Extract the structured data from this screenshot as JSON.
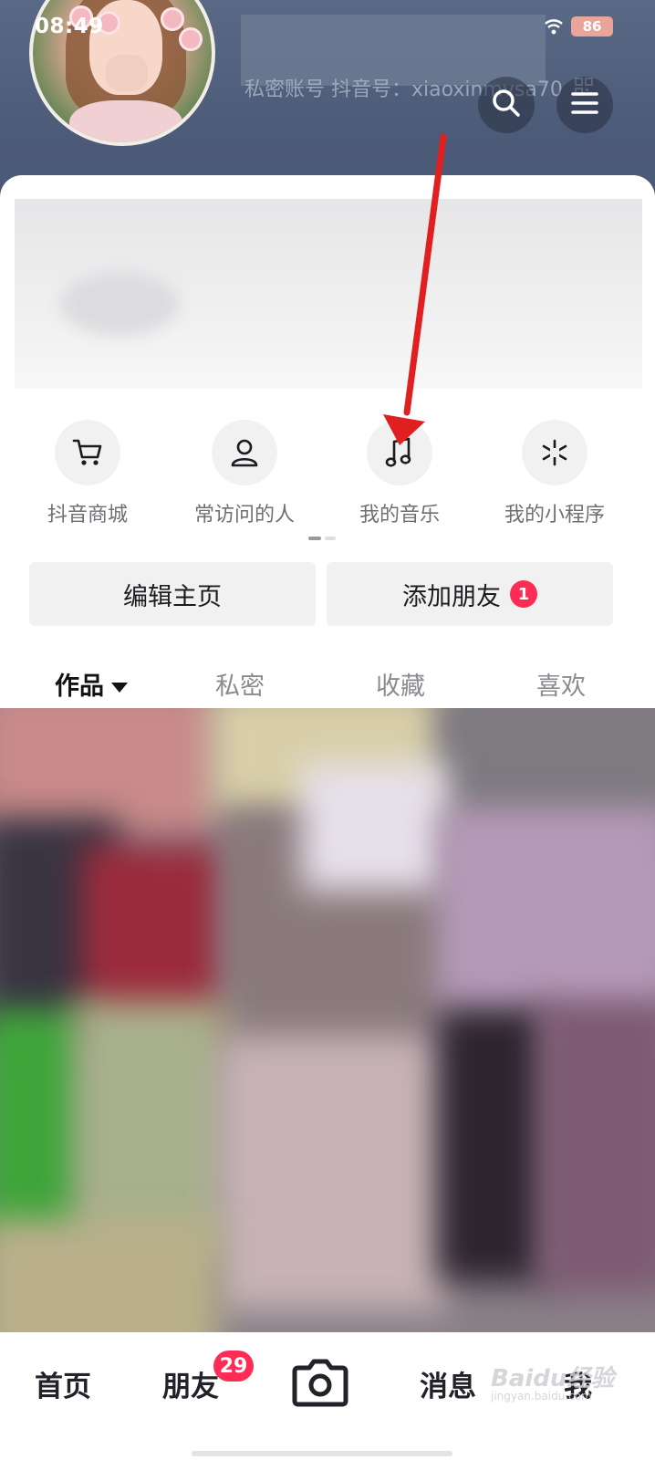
{
  "status_bar": {
    "time": "08:49",
    "battery": "86"
  },
  "profile_header": {
    "sub_info_partial": "私密账号    抖音号：xiaoxinmvsa70",
    "search_icon": "search-icon",
    "menu_icon": "menu-icon"
  },
  "shortcuts": [
    {
      "label": "抖音商城",
      "icon": "cart-icon"
    },
    {
      "label": "常访问的人",
      "icon": "person-icon"
    },
    {
      "label": "我的音乐",
      "icon": "music-note-icon"
    },
    {
      "label": "我的小程序",
      "icon": "mini-program-icon"
    }
  ],
  "actions": {
    "edit_label": "编辑主页",
    "add_friend_label": "添加朋友",
    "add_friend_badge": "1"
  },
  "tabs": [
    {
      "label": "作品",
      "active": true
    },
    {
      "label": "私密",
      "active": false
    },
    {
      "label": "收藏",
      "active": false
    },
    {
      "label": "喜欢",
      "active": false
    }
  ],
  "bottom_nav": {
    "home": "首页",
    "friends": "朋友",
    "friends_badge": "29",
    "messages": "消息",
    "me": "我"
  },
  "watermark": {
    "brand": "Baidu经验",
    "url": "jingyan.baidu.com"
  },
  "colors": {
    "accent_red": "#fe2c55",
    "header_bg": "#4c5b78",
    "annotation_arrow": "#e02020"
  }
}
